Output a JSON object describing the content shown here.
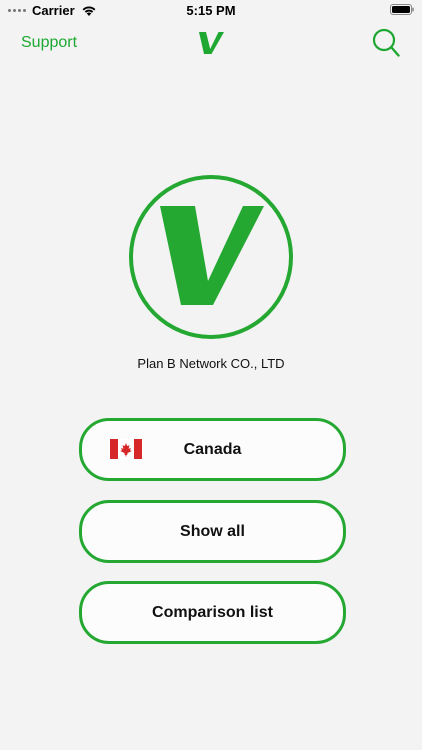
{
  "status": {
    "carrier": "Carrier",
    "time": "5:15 PM"
  },
  "nav": {
    "support_label": "Support"
  },
  "company_name": "Plan B Network CO., LTD",
  "buttons": {
    "country": "Canada",
    "show_all": "Show all",
    "comparison": "Comparison list"
  },
  "colors": {
    "accent": "#1ea832",
    "background": "#f2f3f2"
  },
  "icons": {
    "nav_left": "support-link",
    "nav_center": "v-logo-icon",
    "nav_right": "search-icon",
    "flag": "canada-flag-icon"
  }
}
